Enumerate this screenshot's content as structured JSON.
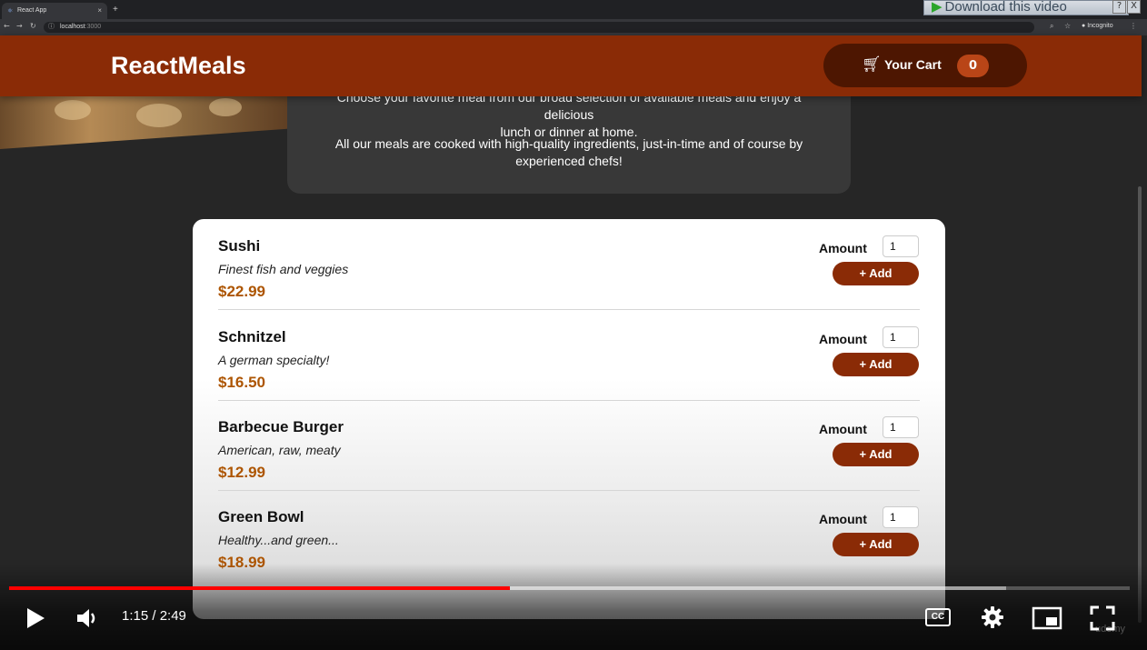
{
  "browser": {
    "tab_title": "React App",
    "tab_close": "×",
    "new_tab": "+",
    "url_host": "localhost",
    "url_port": ":3000",
    "incognito_label": "Incognito"
  },
  "overlay": {
    "download_label": "Download this video",
    "help_label": "?",
    "close_label": "X"
  },
  "header": {
    "brand": "ReactMeals",
    "cart_label": "Your Cart",
    "cart_count": "0"
  },
  "summary": {
    "paragraph1_line1": "Choose your favorite meal from our broad selection of available meals and enjoy a delicious",
    "paragraph1_line2": "lunch or dinner at home.",
    "paragraph2_line1": "All our meals are cooked with high-quality ingredients, just-in-time and of course by",
    "paragraph2_line2": "experienced chefs!"
  },
  "meals": [
    {
      "name": "Sushi",
      "description": "Finest fish and veggies",
      "price": "$22.99",
      "amount_label": "Amount",
      "amount_value": "1",
      "add_label": "+ Add"
    },
    {
      "name": "Schnitzel",
      "description": "A german specialty!",
      "price": "$16.50",
      "amount_label": "Amount",
      "amount_value": "1",
      "add_label": "+ Add"
    },
    {
      "name": "Barbecue Burger",
      "description": "American, raw, meaty",
      "price": "$12.99",
      "amount_label": "Amount",
      "amount_value": "1",
      "add_label": "+ Add"
    },
    {
      "name": "Green Bowl",
      "description": "Healthy...and green...",
      "price": "$18.99",
      "amount_label": "Amount",
      "amount_value": "1",
      "add_label": "+ Add"
    }
  ],
  "watermark": "udemy",
  "player": {
    "time": "1:15 / 2:49",
    "cc_label": "CC",
    "played_fraction": 0.447,
    "buffered_fraction": 0.89
  },
  "colors": {
    "header": "#8a2b06",
    "cart_button": "#4d1601",
    "badge": "#b94517",
    "price": "#ad5502",
    "progress_played": "#ff0000"
  }
}
